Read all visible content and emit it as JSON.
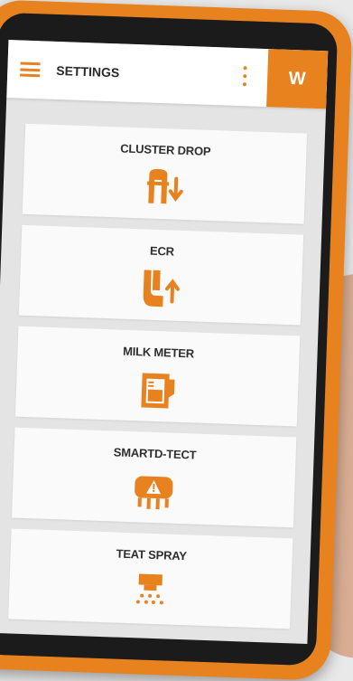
{
  "header": {
    "title": "SETTINGS",
    "brand_logo": "W",
    "menu_icon": "hamburger-icon",
    "more_icon": "kebab-icon"
  },
  "colors": {
    "accent": "#e8821f",
    "text": "#2e2e2e"
  },
  "settings": [
    {
      "label": "CLUSTER DROP",
      "icon": "cluster-drop-icon"
    },
    {
      "label": "ECR",
      "icon": "ecr-icon"
    },
    {
      "label": "MILK METER",
      "icon": "milk-meter-icon"
    },
    {
      "label": "SMARTD-TECT",
      "icon": "smartd-tect-icon"
    },
    {
      "label": "TEAT SPRAY",
      "icon": "teat-spray-icon"
    }
  ]
}
